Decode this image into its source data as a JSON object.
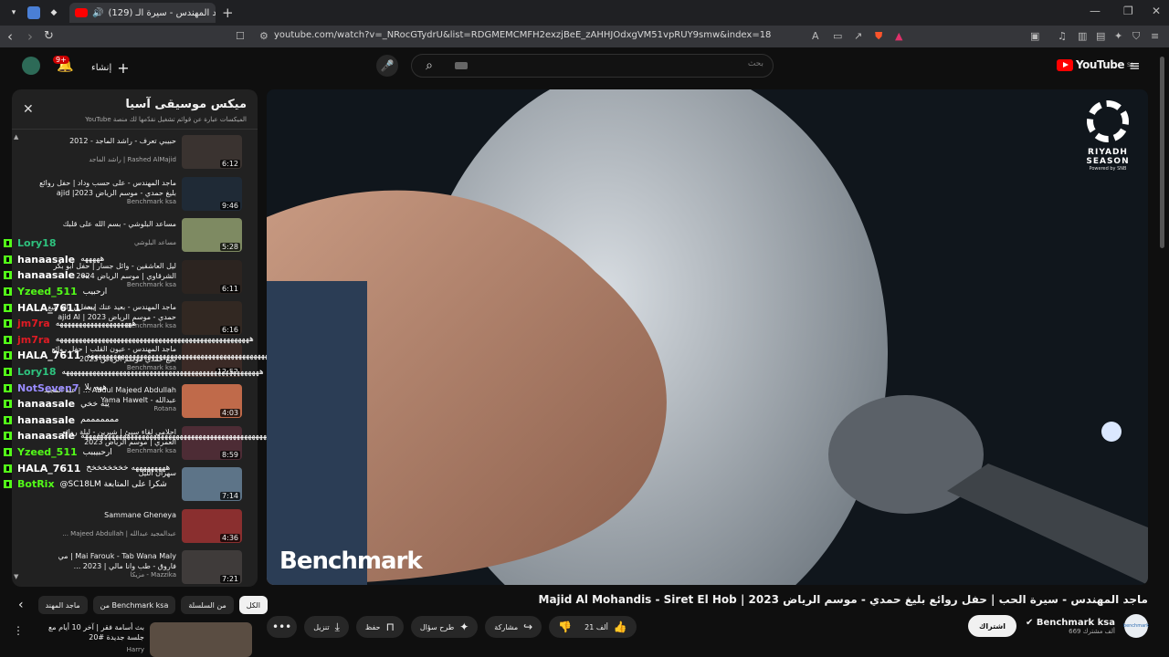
{
  "browser": {
    "tab_title": "(129) ماجد المهندس - سيرة الـ",
    "url": "youtube.com/watch?v=_NRocGTydrU&list=RDGMEMCMFH2exzjBeE_zAHHJOdxgVM51vpRUY9smw&index=18"
  },
  "header": {
    "notif_count": "9+",
    "create_label": "إنشاء",
    "search_placeholder": "بحث",
    "logo_text": "YouTube",
    "logo_region": "SA"
  },
  "playlist": {
    "title": "ميكس موسيقى آسيا",
    "subtitle": "الميكسات عبارة عن قوائم تشغيل نقدّمها لك منصة YouTube",
    "items": [
      {
        "title": "حبيبي تعرف - راشد الماجد - 2012",
        "channel": "Rashed AlMajid | راشد الماجد",
        "duration": "6:12"
      },
      {
        "title": "ماجد المهندس - على حسب وداد | حفل روائع بليغ حمدي - موسم الرياض 2023| ajid",
        "channel": "Benchmark ksa",
        "duration": "9:46"
      },
      {
        "title": "مساعد البلوشي - بسم الله على قلبك",
        "channel": "مساعد البلوشي",
        "duration": "5:28"
      },
      {
        "title": "ليل العاشقين - وائل جسار | حفل ابو بكر الشرقاوي | موسم الرياض 2024",
        "channel": "Benchmark ksa",
        "duration": "6:11"
      },
      {
        "title": "ماجد المهندس - بعيد عنك | حفل روائع بليغ حمدي - موسم الرياض 2023 | ajid Al",
        "channel": "Benchmark ksa",
        "duration": "6:16"
      },
      {
        "title": "ماجد المهندس - عيون القلب | حفل روائع بليغ حمدي موسم الرياض 2023",
        "channel": "Benchmark ksa",
        "duration": "12:52"
      },
      {
        "title": "Abdul Majeed Abdullah ... | عبد المجيد عبدالله - Yama Hawelt",
        "channel": "Rotana",
        "duration": "4:03"
      },
      {
        "title": "احلامي لقاء سيئ | شيرين - ليلة روائع العمري | موسم الرياض 2023",
        "channel": "Benchmark ksa",
        "duration": "8:59"
      },
      {
        "title": "سهران الليل",
        "channel": "",
        "duration": "7:14"
      },
      {
        "title": "Sammane Gheneya",
        "channel": "عبدالمجيد عبدالله | Majeed Abdullah ...",
        "duration": "4:36"
      },
      {
        "title": "Mai Farouk - Tab Wana Maly | مي فاروق - طب وانا مالي | 2023 ...",
        "channel": "Mazzika - مزيكا",
        "duration": "7:21"
      }
    ]
  },
  "chat": [
    {
      "user": "Lory18",
      "color": "#2ec27e",
      "message": ""
    },
    {
      "user": "hanaasale",
      "color": "#ffffff",
      "message": "هههههه"
    },
    {
      "user": "hanaasale",
      "color": "#ffffff",
      "message": "يبه"
    },
    {
      "user": "Yzeed_511",
      "color": "#53fc18",
      "message": "ارحبيب"
    },
    {
      "user": "HALA_7611",
      "color": "#ffffff",
      "message": "يبه"
    },
    {
      "user": "jm7ra",
      "color": "#e01b24",
      "message": "ههههههههههههههههههههه"
    },
    {
      "user": "jm7ra",
      "color": "#e01b24",
      "message": "هههههههههههههههههههههههههههههههههههههههههههههههههههه"
    },
    {
      "user": "HALA_7611",
      "color": "#ffffff",
      "message": "ههههههههههههههههههههههههههههههههههههههههههههههههههههههه"
    },
    {
      "user": "Lory18",
      "color": "#2ec27e",
      "message": "ههههههههههههههههههههههههههههههههههههههههههههههههههههه"
    },
    {
      "user": "NotSeven7",
      "color": "#9a8cff",
      "message": "ههه يلا"
    },
    {
      "user": "hanaasale",
      "color": "#ffffff",
      "message": "يبه خخي"
    },
    {
      "user": "hanaasale",
      "color": "#ffffff",
      "message": "مممممممم"
    },
    {
      "user": "hanaasale",
      "color": "#ffffff",
      "message": "ههههههههههههههههههههههههههههههههههههههههههههههههههههههههه"
    },
    {
      "user": "Yzeed_511",
      "color": "#53fc18",
      "message": "ارحبيببب"
    },
    {
      "user": "HALA_7611",
      "color": "#ffffff",
      "message": "هههههههههه خخخخخخخخ"
    },
    {
      "user": "BotRix",
      "color": "#53fc18",
      "message": "@SC18LM شكرا على المتابعة"
    }
  ],
  "video": {
    "watermark": "Benchmark",
    "season_line1": "RIYADH",
    "season_line2": "SEASON",
    "season_powered": "Powered by SNB",
    "title": "ماجد المهندس - سيرة الحب | حفل روائع بليغ حمدي - موسم الرياض 2023 | Majid Al Mohandis - Siret El Hob"
  },
  "actions": {
    "likes": "21 ألف",
    "share": "مشاركة",
    "ask": "طرح سؤال",
    "save": "حفظ",
    "download": "تنزيل"
  },
  "channel": {
    "name": "Benchmark ksa",
    "subs": "669 ألف مشترك",
    "subscribe": "اشتراك",
    "avatar_text": "benchmark"
  },
  "chips": [
    "الكل",
    "من السلسلة",
    "من Benchmark ksa",
    "ماجد المهند"
  ],
  "related": {
    "title": "بث أسامة فقر | آخر 10 أيام مع جلسة جديدة #20",
    "channel": "Harry"
  }
}
